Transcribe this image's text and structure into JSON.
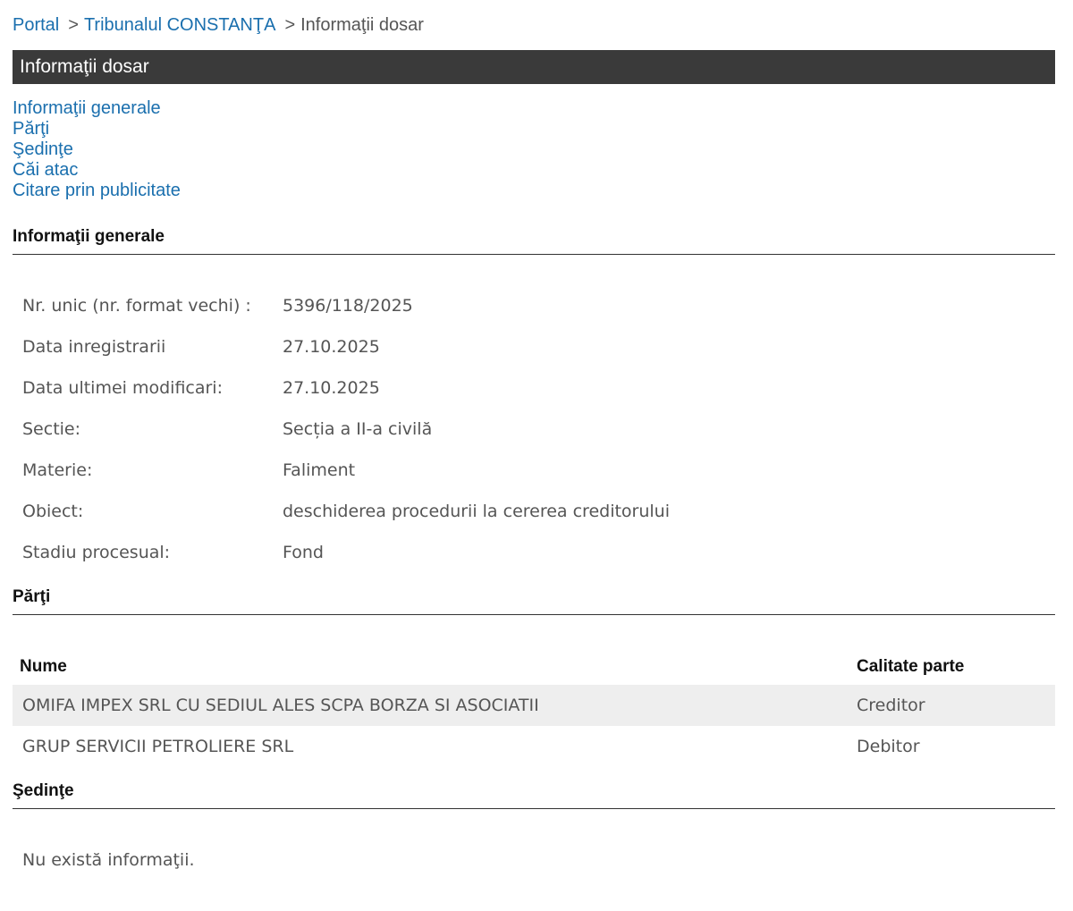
{
  "breadcrumb": {
    "items": [
      "Portal",
      "Tribunalul CONSTANŢA"
    ],
    "separator": ">",
    "current": "Informaţii dosar"
  },
  "title": "Informaţii dosar",
  "nav": {
    "links": [
      "Informaţii generale",
      "Părţi",
      "Şedinţe",
      "Căi atac",
      "Citare prin publicitate"
    ]
  },
  "general": {
    "heading": "Informaţii generale",
    "rows": [
      {
        "label": "Nr. unic (nr. format vechi) :",
        "value": "5396/118/2025"
      },
      {
        "label": "Data inregistrarii",
        "value": "27.10.2025"
      },
      {
        "label": "Data ultimei modificari:",
        "value": "27.10.2025"
      },
      {
        "label": "Sectie:",
        "value": "Secția a II-a civilă"
      },
      {
        "label": "Materie:",
        "value": "Faliment"
      },
      {
        "label": "Obiect:",
        "value": "deschiderea procedurii la cererea creditorului"
      },
      {
        "label": "Stadiu procesual:",
        "value": "Fond"
      }
    ]
  },
  "parti": {
    "heading": "Părţi",
    "columns": [
      "Nume",
      "Calitate parte"
    ],
    "rows": [
      {
        "name": "OMIFA IMPEX SRL CU SEDIUL ALES SCPA BORZA SI ASOCIATII",
        "role": "Creditor"
      },
      {
        "name": "GRUP SERVICII PETROLIERE SRL",
        "role": "Debitor"
      }
    ]
  },
  "sedinte": {
    "heading": "Şedinţe",
    "empty": "Nu există informaţii."
  },
  "colors": {
    "link": "#1a6fae",
    "title_bar": "#3a3a3a",
    "row_alt": "#eeeeee"
  }
}
